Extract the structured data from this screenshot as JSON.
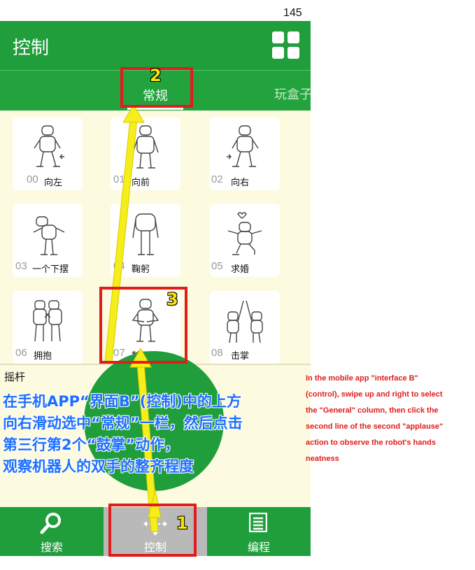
{
  "page_number": "145",
  "app": {
    "title": "控制",
    "grid_icon": "grid-icon",
    "tabs": [
      {
        "label": "常规",
        "active": true
      },
      {
        "label": "玩盒子",
        "active": false
      }
    ]
  },
  "actions": [
    {
      "num": "00",
      "label": "向左"
    },
    {
      "num": "01",
      "label": "向前"
    },
    {
      "num": "02",
      "label": "向右"
    },
    {
      "num": "03",
      "label": "一个下摆"
    },
    {
      "num": "04",
      "label": "鞠躬"
    },
    {
      "num": "05",
      "label": "求婚"
    },
    {
      "num": "06",
      "label": "拥抱"
    },
    {
      "num": "07",
      "label": "鼓掌"
    },
    {
      "num": "08",
      "label": "击掌"
    }
  ],
  "joystick": {
    "label": "摇杆"
  },
  "bottom_nav": [
    {
      "label": "搜索",
      "icon": "search-icon"
    },
    {
      "label": "控制",
      "icon": "move-icon"
    },
    {
      "label": "编程",
      "icon": "list-icon"
    }
  ],
  "annotations": {
    "badge_1": "1",
    "badge_2": "2",
    "badge_3": "3",
    "instruction_zh": [
      "在手机APP“界面B”(控制)中的上方",
      "向右滑动选中“常规”一栏，然后点击",
      "第三行第2个“鼓掌”动作，",
      "观察机器人的双手的整齐程度"
    ],
    "instruction_en": [
      "In the mobile app \"interface B\"",
      "(control), swipe up and right to select",
      "the \"General\" column, then click the",
      "second line of the second \"applause\"",
      "action to observe the robot's hands",
      "neatness"
    ]
  },
  "colors": {
    "app_green": "#1f9e3b",
    "highlight_red": "#e01c1c",
    "arrow_yellow": "#f6ee1a",
    "instruction_blue": "#1e6fff"
  }
}
